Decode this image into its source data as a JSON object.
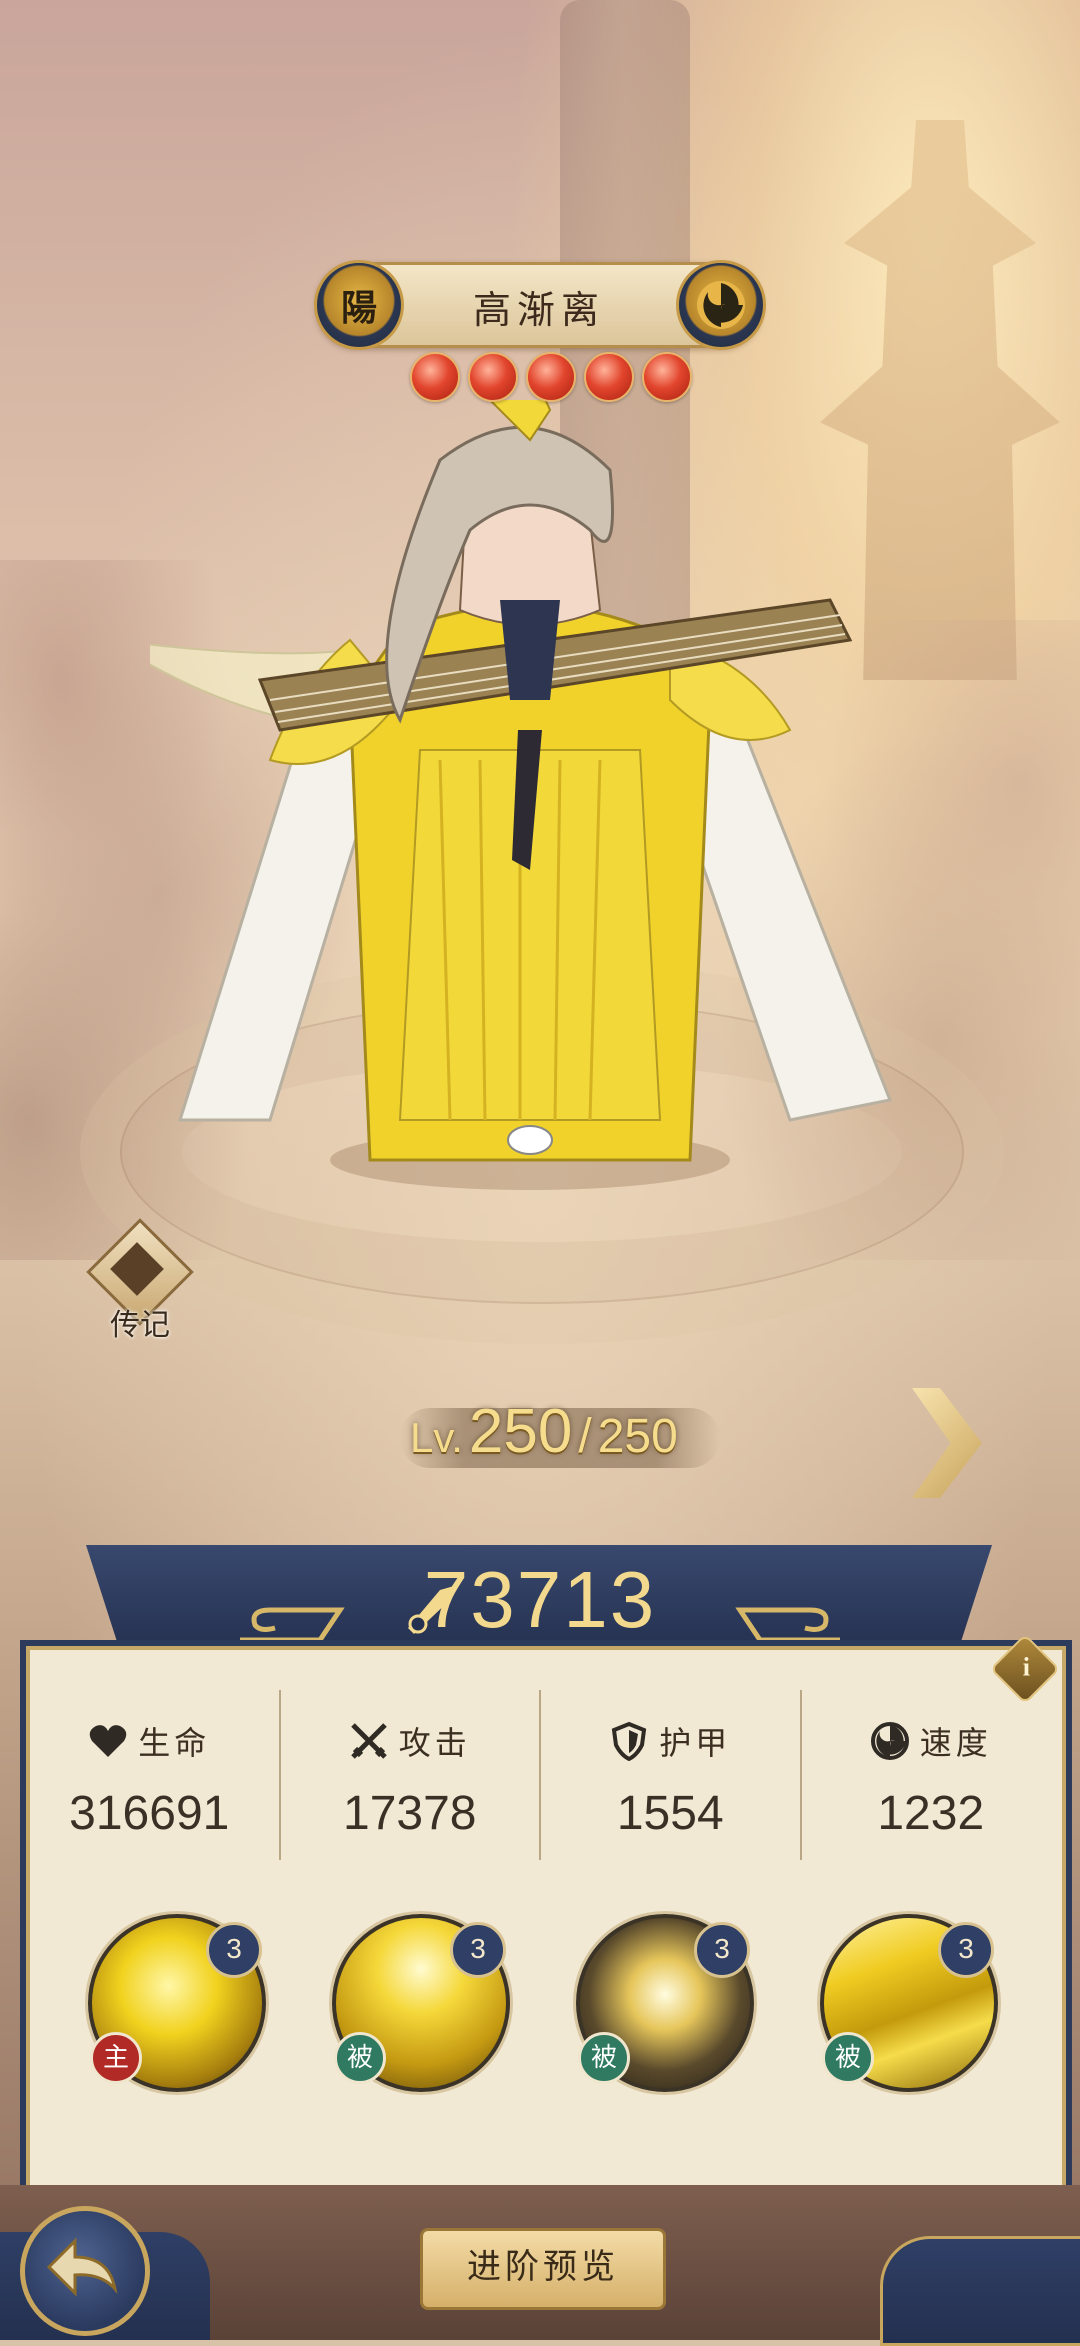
{
  "hero": {
    "name": "高渐离",
    "faction_glyph": "陽",
    "stars": 5
  },
  "lore": {
    "label": "传记"
  },
  "level": {
    "prefix": "Lv.",
    "current": "250",
    "separator": "/",
    "max": "250"
  },
  "power": {
    "value": "73713"
  },
  "stats": [
    {
      "label": "生命",
      "value": "316691",
      "icon": "heart-icon"
    },
    {
      "label": "攻击",
      "value": "17378",
      "icon": "crossed-swords-icon"
    },
    {
      "label": "护甲",
      "value": "1554",
      "icon": "shield-icon"
    },
    {
      "label": "速度",
      "value": "1232",
      "icon": "swirl-icon"
    }
  ],
  "skills": [
    {
      "level": "3",
      "type": "主"
    },
    {
      "level": "3",
      "type": "被"
    },
    {
      "level": "3",
      "type": "被"
    },
    {
      "level": "3",
      "type": "被"
    }
  ],
  "info_glyph": "i",
  "buttons": {
    "advance_preview": "进阶预览"
  },
  "colors": {
    "navy": "#2c3a5c",
    "gold": "#c9a55a",
    "panel": "#f1e9d4",
    "star_red": "#e2452d",
    "passive_green": "#2f7a60",
    "active_red": "#b22a25"
  }
}
